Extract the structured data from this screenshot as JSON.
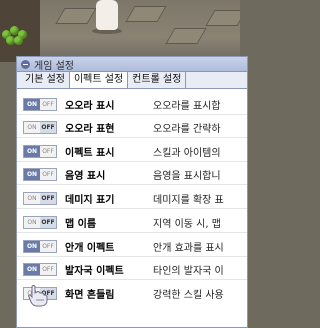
{
  "window": {
    "title": "게임 설정"
  },
  "tabs": [
    {
      "label": "기본 설정",
      "active": false
    },
    {
      "label": "이펙트 설정",
      "active": true
    },
    {
      "label": "컨트롤 설정",
      "active": false
    }
  ],
  "toggle_labels": {
    "on": "ON",
    "off": "OFF"
  },
  "settings": [
    {
      "name": "오오라 표시",
      "desc": "오오라를 표시합",
      "state": "on"
    },
    {
      "name": "오오라 표현",
      "desc": "오오라를 간략하",
      "state": "off"
    },
    {
      "name": "이펙트 표시",
      "desc": "스킬과 아이템의",
      "state": "on"
    },
    {
      "name": "음영 표시",
      "desc": "음영을 표시합니",
      "state": "on"
    },
    {
      "name": "데미지 표기",
      "desc": "데미지를 확장 표",
      "state": "off"
    },
    {
      "name": "맵 이름",
      "desc": "지역 이동 시, 맵",
      "state": "off"
    },
    {
      "name": "안개 이펙트",
      "desc": "안개 효과를 표시",
      "state": "on"
    },
    {
      "name": "발자국 이펙트",
      "desc": "타인의 발자국 이",
      "state": "on"
    },
    {
      "name": "화면 흔들림",
      "desc": "강력한 스킬 사용",
      "state": "off"
    }
  ]
}
